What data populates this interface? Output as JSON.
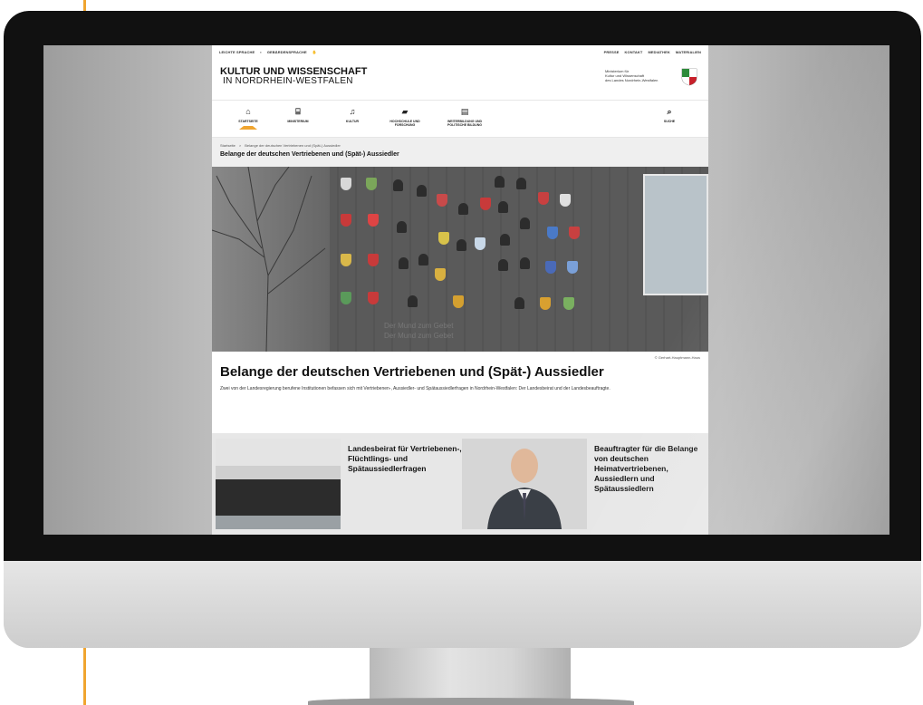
{
  "utility_bar": {
    "left": [
      "LEICHTE SPRACHE",
      "GEBÄRDENSPRACHE"
    ],
    "right": [
      "PRESSE",
      "KONTAKT",
      "MEDIATHEK",
      "MATERIALIEN"
    ]
  },
  "site": {
    "title_line1": "KULTUR UND WISSENSCHAFT",
    "title_line2": "IN NORDRHEIN-WESTFALEN",
    "ministry_lines": [
      "Ministerium für",
      "Kultur und Wissenschaft",
      "des Landes Nordrhein-Westfalen"
    ]
  },
  "nav": {
    "items": [
      {
        "label": "STARTSEITE",
        "icon": "home-icon"
      },
      {
        "label": "MINISTERIUM",
        "icon": "building-icon"
      },
      {
        "label": "KULTUR",
        "icon": "music-icon"
      },
      {
        "label_line1": "HOCHSCHULE UND",
        "label_line2": "FORSCHUNG",
        "icon": "graduation-icon"
      },
      {
        "label_line1": "WEITERBILDUNG UND",
        "label_line2": "POLITISCHE BILDUNG",
        "icon": "book-icon"
      }
    ],
    "search_label": "SUCHE",
    "accent_color": "#f0a530"
  },
  "breadcrumb": {
    "home": "Startseite",
    "separator": ">",
    "current": "Belange der deutschen Vertriebenen und (Spät-) Aussiedler"
  },
  "page_heading": "Belange der deutschen Vertriebenen und (Spät-) Aussiedler",
  "hero": {
    "plaque_line1": "Der Mund zum Gebet",
    "plaque_line2": "Der Mund zum Gebet",
    "copyright": "© Gerhart-Hauptmann-Haus"
  },
  "main_title": "Belange der deutschen Vertriebenen und (Spät-) Aussiedler",
  "intro_text": "Zwei von der Landesregierung berufene Institutionen befassen sich mit Vertriebenen-, Aussiedler- und Spätaussiedlerfragen in Nordrhein-Westfalen: Der Landesbeirat und der Landesbeauftragte.",
  "teasers": [
    {
      "title": "Landesbeirat für Vertriebenen-, Flüchtlings- und Spätaussiedlerfragen"
    },
    {
      "title": "Beauftragter für die Belange von deutschen Heimatvertriebenen, Aussiedlern und Spätaussiedlern"
    }
  ]
}
